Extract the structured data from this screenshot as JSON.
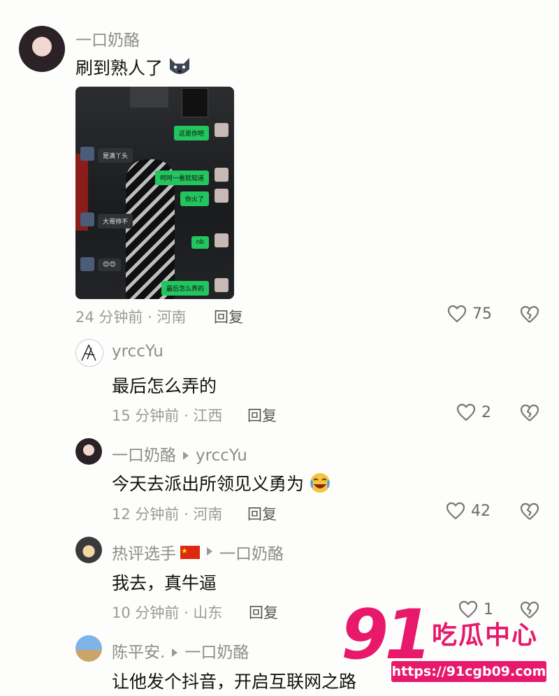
{
  "comments": [
    {
      "author": "一口奶酪",
      "text": "刷到熟人了",
      "emoji": "husky-emoji",
      "time_location": "24 分钟前 · 河南",
      "reply_label": "回复",
      "likes": "75",
      "screenshot": {
        "messages": [
          {
            "side": "me",
            "text": "这是你吧"
          },
          {
            "side": "other",
            "text": "是滴丫头"
          },
          {
            "side": "me",
            "text": "呵呵一看就知道"
          },
          {
            "side": "me",
            "text": "你火了"
          },
          {
            "side": "other",
            "text": "大哥帅不"
          },
          {
            "side": "me",
            "text": "nb"
          },
          {
            "side": "other",
            "text": "😊😊"
          },
          {
            "side": "me",
            "text": "最后怎么弄的"
          }
        ]
      }
    },
    {
      "author": "yrccYu",
      "text": "最后怎么弄的",
      "time_location": "15 分钟前 · 江西",
      "reply_label": "回复",
      "likes": "2"
    },
    {
      "author": "一口奶酪",
      "reply_to": "yrccYu",
      "text": "今天去派出所领见义勇为",
      "emoji": "laugh-cry-emoji",
      "time_location": "12 分钟前 · 河南",
      "reply_label": "回复",
      "likes": "42"
    },
    {
      "author": "热评选手",
      "flag": "cn-flag",
      "reply_to": "一口奶酪",
      "text": "我去，真牛逼",
      "time_location": "10 分钟前 · 山东",
      "reply_label": "回复",
      "likes": "1"
    },
    {
      "author": "陈平安.",
      "reply_to": "一口奶酪",
      "text": "让他发个抖音，开启互联网之路"
    }
  ],
  "watermark": {
    "number": "91",
    "brand": "吃瓜中心",
    "url": "https://91cgb09.com"
  },
  "colors": {
    "background": "#fdfdfb",
    "meta_gray": "#9a9a9a",
    "watermark_pink": "#e8196b",
    "bubble_green": "#22c55e"
  }
}
